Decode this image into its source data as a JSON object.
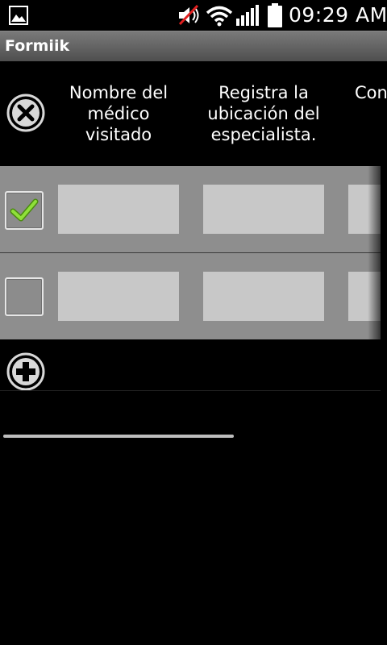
{
  "status_bar": {
    "time": "09:29 AM",
    "icons": [
      "gallery-notification-icon",
      "mute-icon",
      "wifi-icon",
      "signal-icon",
      "battery-icon"
    ]
  },
  "app": {
    "title": "Formiik"
  },
  "table": {
    "columns": [
      {
        "label": "Nombre del médico visitado"
      },
      {
        "label": "Registra la ubicación del especialista."
      },
      {
        "label": "Con"
      }
    ],
    "rows": [
      {
        "checked": true,
        "cells": [
          "",
          "",
          ""
        ]
      },
      {
        "checked": false,
        "cells": [
          "",
          "",
          ""
        ]
      }
    ],
    "delete_icon": "delete-icon",
    "add_icon": "add-icon"
  },
  "colors": {
    "row_background": "#8e8e8e",
    "cell_background": "#c8c8c8",
    "check_green": "#7ed321",
    "title_bar": "#5a5a5a"
  }
}
